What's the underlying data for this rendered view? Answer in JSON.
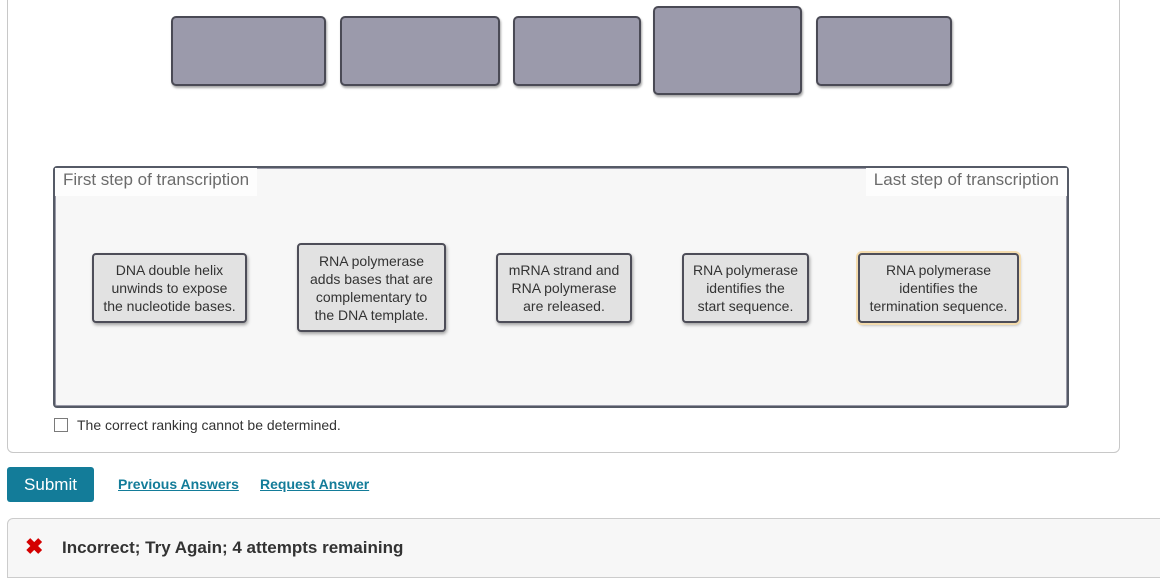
{
  "answer_slots": [
    {
      "label": ""
    },
    {
      "label": ""
    },
    {
      "label": ""
    },
    {
      "label": ""
    },
    {
      "label": ""
    }
  ],
  "ranking": {
    "left_label": "First step of transcription",
    "right_label": "Last step of transcription",
    "cards": [
      {
        "text": "DNA double helix\nunwinds to expose\nthe nucleotide bases."
      },
      {
        "text": "RNA polymerase\nadds bases that are\ncomplementary to\nthe DNA template."
      },
      {
        "text": "mRNA strand and\nRNA polymerase\nare released."
      },
      {
        "text": "RNA polymerase\nidentifies the\nstart sequence."
      },
      {
        "text": "RNA polymerase\nidentifies the\ntermination sequence."
      }
    ]
  },
  "cannot_determine": {
    "label": "The correct ranking cannot be determined.",
    "checked": false
  },
  "actions": {
    "submit_label": "Submit",
    "previous_answers_label": "Previous Answers",
    "request_answer_label": "Request Answer"
  },
  "feedback": {
    "icon": "✖",
    "text": "Incorrect; Try Again; 4 attempts remaining"
  },
  "colors": {
    "accent": "#137c99",
    "slot_fill": "#9b9aab",
    "error": "#d40000"
  }
}
